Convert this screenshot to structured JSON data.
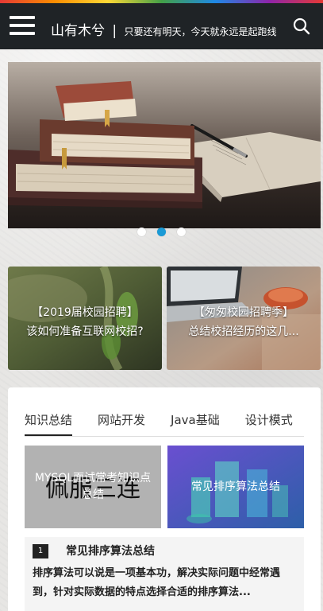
{
  "header": {
    "title": "山有木兮",
    "separator": "|",
    "tagline": "只要还有明天，今天就永远是起跑线",
    "menu_icon": "hamburger-menu-icon",
    "search_icon": "search-icon"
  },
  "carousel": {
    "image": "books-and-notebook-on-table",
    "active_index": 1,
    "slides": 3
  },
  "featured": [
    {
      "line1": "【2019届校园招聘】",
      "line2": "该如何准备互联网校招?"
    },
    {
      "line1": "【匆匆校园招聘季】",
      "line2": "总结校招经历的这几..."
    }
  ],
  "tabs": [
    "知识总结",
    "网站开发",
    "Java基础",
    "设计模式"
  ],
  "articles": [
    {
      "title": "MYSQL面试常考知识点总结",
      "overlay_text": "佩服三连"
    },
    {
      "title": "常见排序算法总结"
    }
  ],
  "list": [
    {
      "rank": "1",
      "title": "常见排序算法总结",
      "desc": "排序算法可以说是一项基本功，解决实际问题中经常遇到，针对实际数据的特点选择合适的排序算法..."
    }
  ],
  "colors": {
    "topbar": "#1f2326",
    "accent": "#1a9ad6"
  }
}
